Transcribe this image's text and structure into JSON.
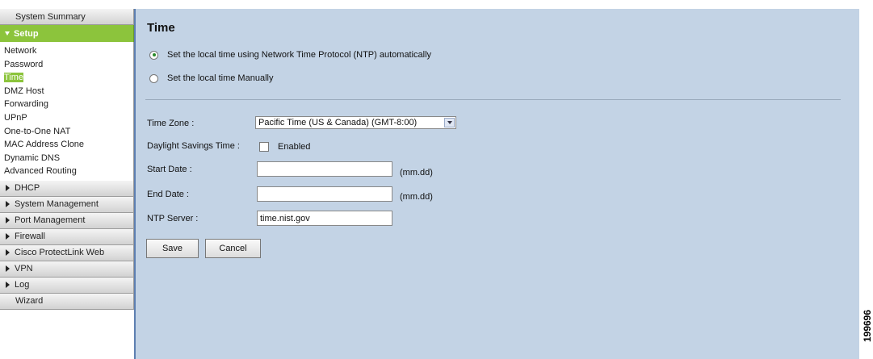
{
  "sidebar": {
    "system_summary": "System Summary",
    "setup": "Setup",
    "setup_items": [
      "Network",
      "Password",
      "Time",
      "DMZ Host",
      "Forwarding",
      "UPnP",
      "One-to-One NAT",
      "MAC Address Clone",
      "Dynamic DNS",
      "Advanced Routing"
    ],
    "active_item": "Time",
    "sections": [
      "DHCP",
      "System Management",
      "Port Management",
      "Firewall",
      "Cisco ProtectLink Web",
      "VPN",
      "Log"
    ],
    "wizard": "Wizard"
  },
  "main": {
    "title": "Time",
    "radio_ntp": "Set the local time using Network Time Protocol (NTP) automatically",
    "radio_manual": "Set the local time Manually",
    "radio_selected": "ntp",
    "time_zone_label": "Time Zone :",
    "time_zone_value": "Pacific Time (US & Canada) (GMT-8:00)",
    "dst_label": "Daylight Savings Time :",
    "dst_checkbox_label": "Enabled",
    "dst_enabled": false,
    "start_date_label": "Start Date :",
    "start_date_value": "",
    "end_date_label": "End Date :",
    "end_date_value": "",
    "date_unit": "(mm.dd)",
    "ntp_server_label": "NTP Server :",
    "ntp_server_value": "time.nist.gov",
    "save_label": "Save",
    "cancel_label": "Cancel"
  },
  "figure_number": "199696",
  "colors": {
    "setup_green": "#8cc43c",
    "content_bg": "#c3d3e5",
    "content_border": "#5d7fb1"
  }
}
